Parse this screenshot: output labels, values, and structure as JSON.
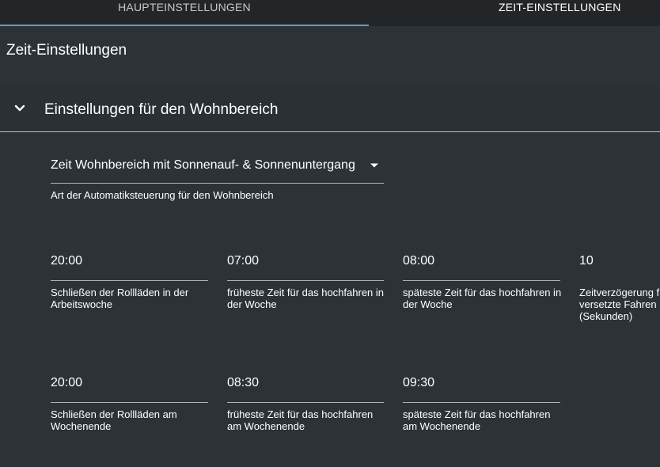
{
  "tabs": {
    "main_label": "HAUPTEINSTELLUNGEN",
    "zeit_label": "ZEIT-EINSTELLUNGEN"
  },
  "section_title": "Zeit-Einstellungen",
  "panel": {
    "title": "Einstellungen für den Wohnbereich",
    "expanded": true
  },
  "mode_select": {
    "value": "Zeit Wohnbereich mit Sonnenauf- & Sonnenuntergang",
    "help": "Art der Automatiksteuerung für den Wohnbereich"
  },
  "fields": [
    {
      "value": "20:00",
      "label": "Schließen der Rollläden in der Arbeitswoche"
    },
    {
      "value": "07:00",
      "label": "früheste Zeit für das hochfahren in der Woche"
    },
    {
      "value": "08:00",
      "label": "späteste Zeit für das hochfahren in der Woche"
    },
    {
      "value": "10",
      "label": "Zeitverzögerung für versetzte Fahren (Sekunden)"
    },
    {
      "value": "20:00",
      "label": "Schließen der Rollläden am Wochenende"
    },
    {
      "value": "08:30",
      "label": "früheste Zeit für das hochfahren am Wochenende"
    },
    {
      "value": "09:30",
      "label": "späteste Zeit für das hochfahren am Wochenende"
    }
  ],
  "icons": {
    "panel_chevron": "chevron-down-icon",
    "select_dropdown": "dropdown-arrow-icon"
  },
  "colors": {
    "background": "#2d3236",
    "tab_bar": "#232629",
    "tab_indicator": "#5a9fd4",
    "text": "#ffffff"
  }
}
